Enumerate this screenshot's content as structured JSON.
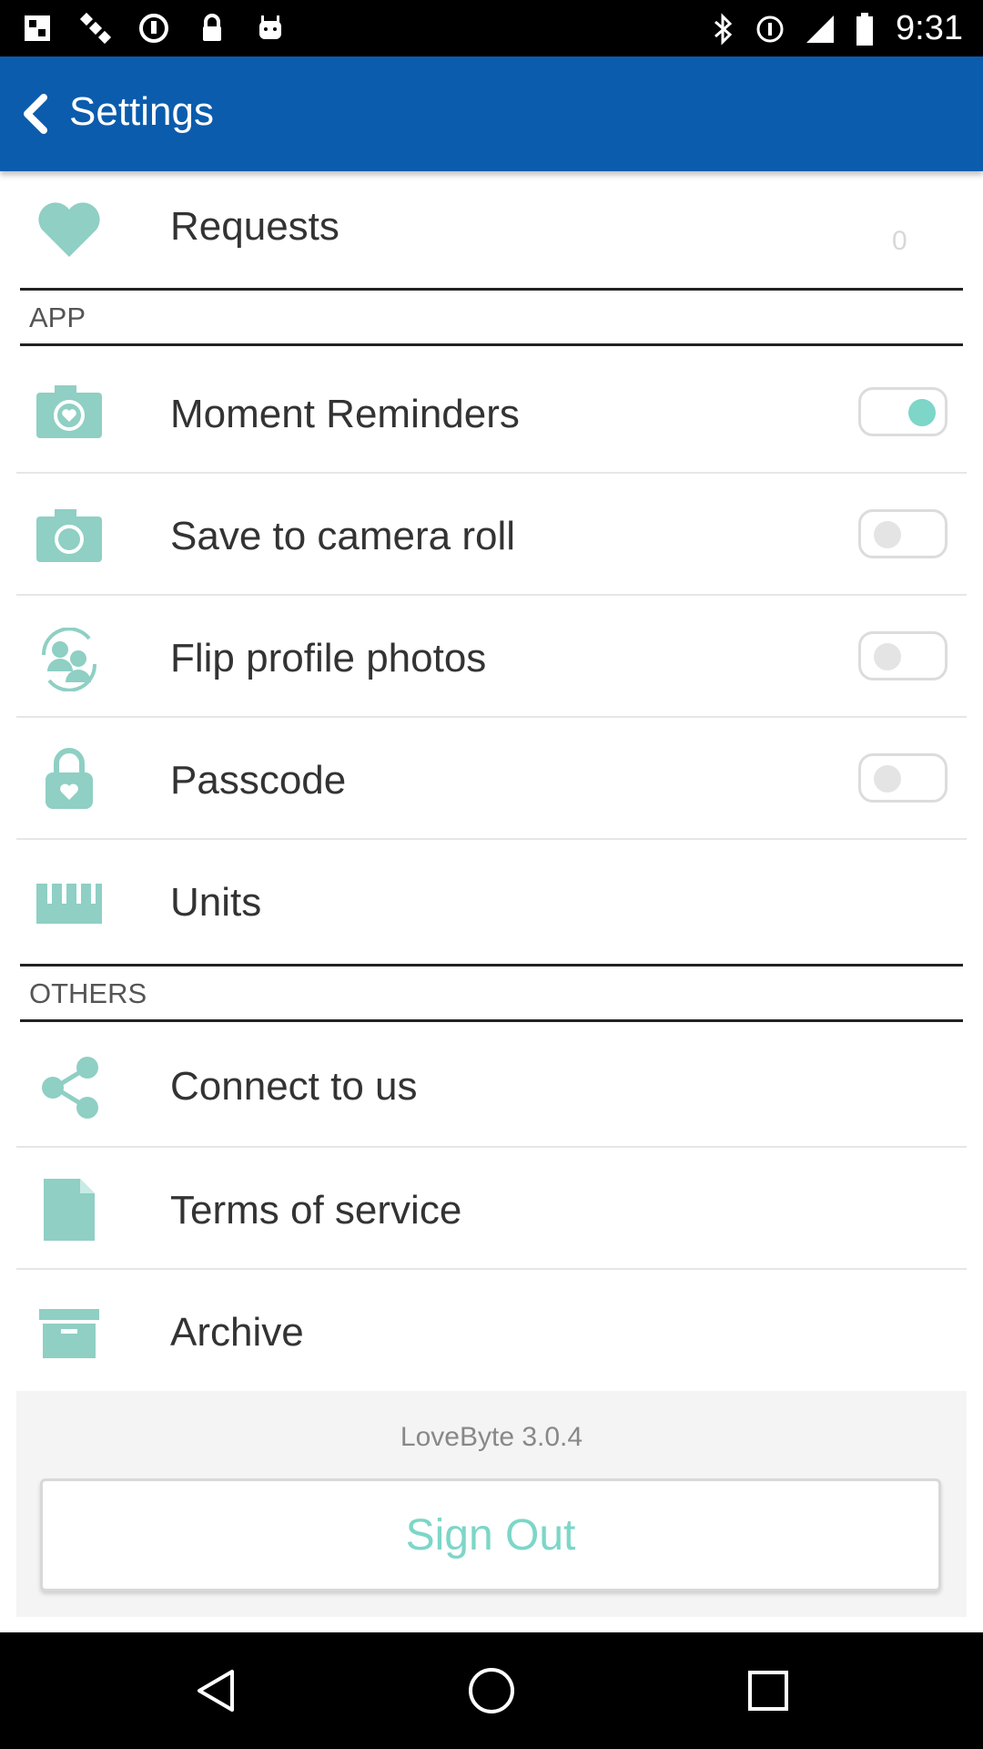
{
  "status_bar": {
    "time": "9:31",
    "left_icons": [
      "fake-gps-icon",
      "satellite-icon",
      "sync-icon",
      "lock-icon",
      "android-icon"
    ],
    "right_icons": [
      "bluetooth-icon",
      "battery-saver-icon",
      "signal-icon",
      "battery-icon"
    ]
  },
  "app_bar": {
    "title": "Settings"
  },
  "requests": {
    "label": "Requests",
    "count": "0"
  },
  "sections": {
    "app": "APP",
    "others": "OTHERS"
  },
  "app_items": [
    {
      "label": "Moment Reminders",
      "toggle": true
    },
    {
      "label": "Save to camera roll",
      "toggle": false
    },
    {
      "label": "Flip profile photos",
      "toggle": false
    },
    {
      "label": "Passcode",
      "toggle": false
    },
    {
      "label": "Units"
    }
  ],
  "other_items": [
    {
      "label": "Connect to us"
    },
    {
      "label": "Terms of service"
    },
    {
      "label": "Archive"
    }
  ],
  "footer": {
    "version": "LoveByte 3.0.4",
    "sign_out": "Sign Out"
  },
  "colors": {
    "primary": "#0b5cad",
    "accent": "#7dd6c8",
    "icon_tint": "#8fcfc4"
  }
}
